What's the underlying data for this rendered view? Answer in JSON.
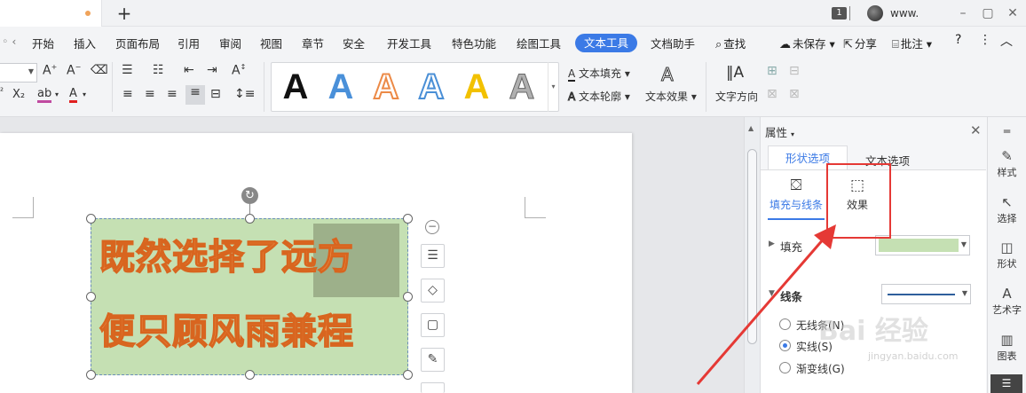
{
  "titlebar": {
    "new_tab_symbol": "+",
    "window_badge": "1",
    "user_name": "www.",
    "minimize_symbol": "–",
    "restore_symbol": "▢",
    "close_symbol": "✕"
  },
  "menu": {
    "items": [
      "开始",
      "插入",
      "页面布局",
      "引用",
      "审阅",
      "视图",
      "章节",
      "安全",
      "开发工具",
      "特色功能",
      "绘图工具"
    ],
    "active": "文本工具",
    "after_active": [
      "文档助手"
    ],
    "search_label": "查找",
    "unsaved_label": "未保存",
    "share_label": "分享",
    "comment_label": "批注",
    "help_symbol": "?",
    "more_symbol": "⋮",
    "collapse_symbol": "︿",
    "accent_color": "#3b7ae6"
  },
  "ribbon": {
    "text_fill_label": "文本填充",
    "text_outline_label": "文本轮廓",
    "text_effect_label": "文本效果",
    "text_direction_label": "文字方向",
    "wordart_glyph": "A",
    "wordart_styles": [
      {
        "name": "black",
        "color": "#111111"
      },
      {
        "name": "blue",
        "color": "#4a90d9"
      },
      {
        "name": "orange-outline",
        "color": "#f0a26a"
      },
      {
        "name": "blue-outline",
        "color": "#ffffff"
      },
      {
        "name": "gold",
        "color": "#f2c100"
      },
      {
        "name": "gray-gradient",
        "color": "#9a9a9a"
      }
    ]
  },
  "document": {
    "line1": "既然选择了远方",
    "line2": "便只顾风雨兼程",
    "fill_color": "#c5e0b3",
    "text_color": "#f29b55"
  },
  "props": {
    "title": "属性",
    "tab_shape": "形状选项",
    "tab_text": "文本选项",
    "subtab_fill": "填充与线条",
    "subtab_effect": "效果",
    "fill_label": "填充",
    "line_label": "线条",
    "radio_none": "无线条(N)",
    "radio_solid": "实线(S)",
    "radio_gradient": "渐变线(G)"
  },
  "sidebar": {
    "items": [
      "样式",
      "选择",
      "形状",
      "艺术字",
      "图表"
    ]
  },
  "watermark": {
    "main": "Bai 经验",
    "sub": "jingyan.baidu.com"
  }
}
